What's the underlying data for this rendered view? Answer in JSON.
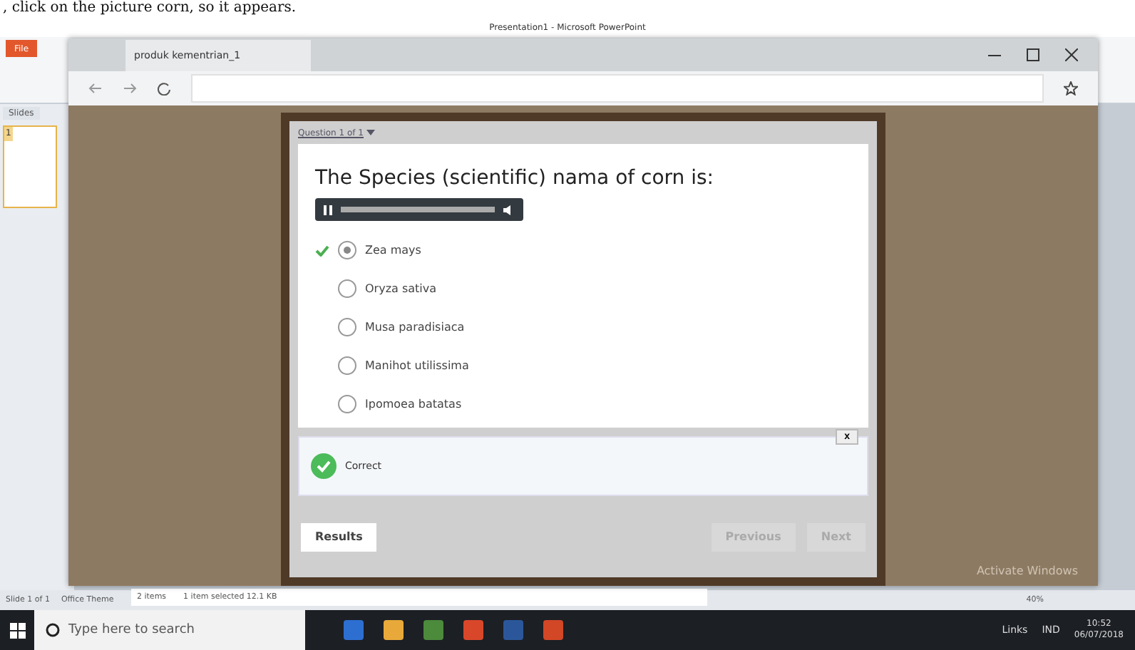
{
  "caption": ", click on the picture corn, so it appears.",
  "app": {
    "title": "Presentation1 - Microsoft PowerPoint",
    "file_tab": "File",
    "panel_tab": "Slides",
    "slide_number": "1",
    "status": [
      "Slide 1 of 1",
      "Office Theme"
    ],
    "zoom": "40%"
  },
  "explorer_status": [
    "2 items",
    "1 item selected  12.1 KB"
  ],
  "browser": {
    "tab_title": "produk kementrian_1"
  },
  "quiz": {
    "header": "Question 1 of 1",
    "question": "The Species (scientific) nama of corn is:",
    "options": [
      {
        "label": "Zea mays",
        "selected": true,
        "correct": true
      },
      {
        "label": "Oryza sativa",
        "selected": false,
        "correct": false
      },
      {
        "label": "Musa paradisiaca",
        "selected": false,
        "correct": false
      },
      {
        "label": "Manihot utilissima",
        "selected": false,
        "correct": false
      },
      {
        "label": "Ipomoea batatas",
        "selected": false,
        "correct": false
      }
    ],
    "feedback": {
      "text": "Correct",
      "close": "x"
    },
    "buttons": [
      {
        "label": "Results",
        "disabled": false
      },
      {
        "label": "Previous",
        "disabled": true
      },
      {
        "label": "Next",
        "disabled": true
      }
    ]
  },
  "os_notice": "Activate Windows",
  "taskbar": {
    "search_placeholder": "Type here to search",
    "tray": [
      "Links",
      "IND"
    ],
    "time": "10:52",
    "date": "06/07/2018"
  }
}
